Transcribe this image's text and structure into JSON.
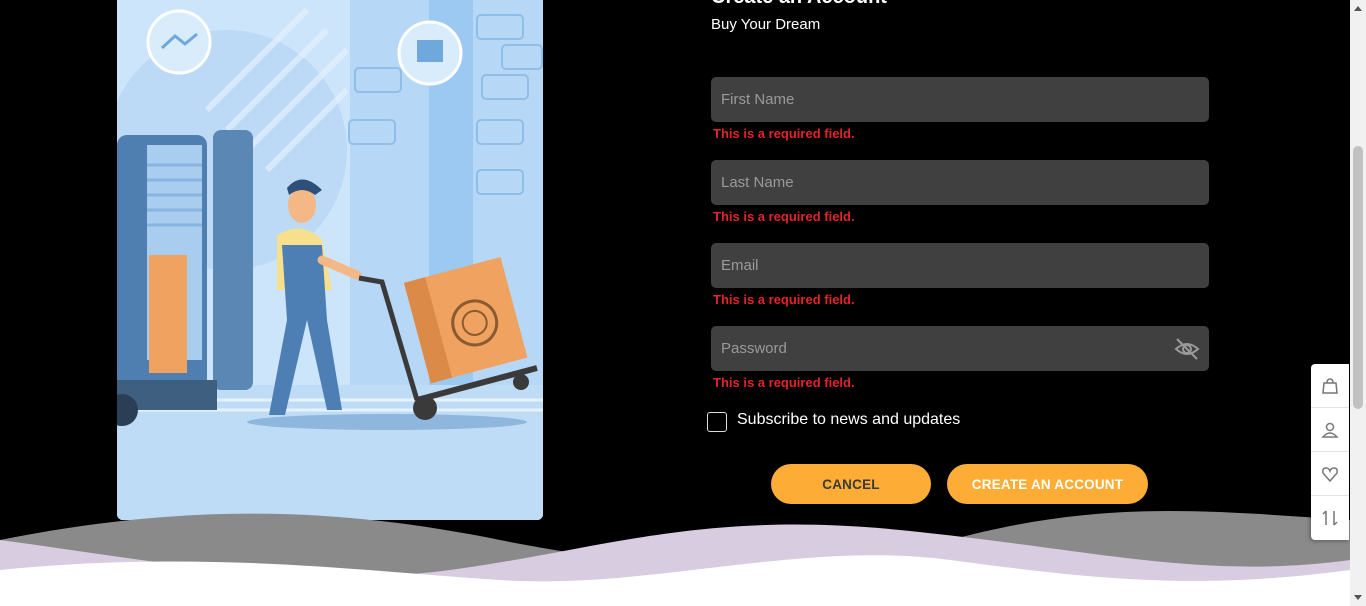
{
  "header": {
    "title": "Create an Account",
    "subtitle": "Buy Your Dream"
  },
  "form": {
    "first_name": {
      "placeholder": "First Name",
      "value": "",
      "error": "This is a required field."
    },
    "last_name": {
      "placeholder": "Last Name",
      "value": "",
      "error": "This is a required field."
    },
    "email": {
      "placeholder": "Email",
      "value": "",
      "error": "This is a required field."
    },
    "password": {
      "placeholder": "Password",
      "value": "",
      "error": "This is a required field."
    },
    "subscribe_label": "Subscribe to news and updates",
    "subscribe_checked": false,
    "cancel_label": "CANCEL",
    "create_label": "CREATE AN ACCOUNT"
  },
  "sidebar": {
    "items": [
      "cart-bag-icon",
      "account-icon",
      "heart-icon",
      "compare-icon"
    ]
  },
  "colors": {
    "accent": "#fdad35",
    "error": "#e3242b",
    "field_bg": "#404040",
    "page_bg": "#000000"
  },
  "icons": {
    "password_toggle": "eye-slash-icon"
  }
}
